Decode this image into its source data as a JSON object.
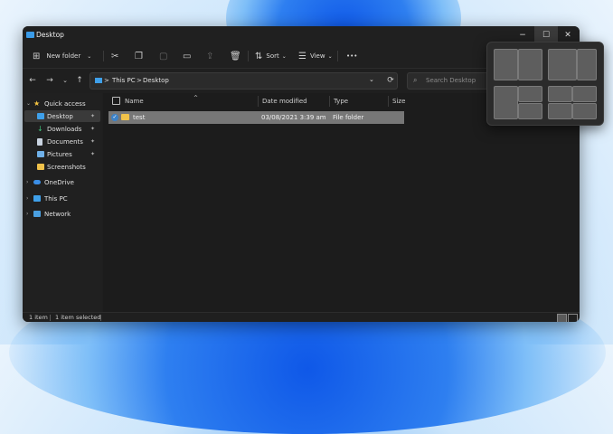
{
  "window": {
    "title": "Desktop",
    "controls": {
      "minimize": "−",
      "maximize": "☐",
      "close": "✕"
    }
  },
  "toolbar": {
    "new_folder": "New folder",
    "sort": "Sort",
    "view": "View",
    "more": "•••"
  },
  "address": {
    "crumbs": [
      "This PC",
      "Desktop"
    ],
    "separator": ">",
    "search_placeholder": "Search Desktop"
  },
  "nav": {
    "items": [
      {
        "label": "Quick access",
        "icon": "star-icon"
      },
      {
        "label": "Desktop",
        "icon": "desktop-icon",
        "pinned": true,
        "selected": true
      },
      {
        "label": "Downloads",
        "icon": "download-icon",
        "pinned": true
      },
      {
        "label": "Documents",
        "icon": "documents-icon",
        "pinned": true
      },
      {
        "label": "Pictures",
        "icon": "pictures-icon",
        "pinned": true
      },
      {
        "label": "Screenshots",
        "icon": "folder-icon"
      },
      {
        "label": "OneDrive",
        "icon": "cloud-icon"
      },
      {
        "label": "This PC",
        "icon": "pc-icon"
      },
      {
        "label": "Network",
        "icon": "network-icon"
      }
    ]
  },
  "columns": {
    "name": "Name",
    "date": "Date modified",
    "type": "Type",
    "size": "Size"
  },
  "files": [
    {
      "name": "test",
      "date": "03/08/2021 3:39 am",
      "type": "File folder",
      "size": ""
    }
  ],
  "status": {
    "count": "1 item",
    "selected": "1 item selected"
  },
  "colors": {
    "accent": "#3c82c8",
    "folder": "#f1c24a",
    "selected_row": "#777777",
    "window_bg": "#1f1f1f"
  }
}
